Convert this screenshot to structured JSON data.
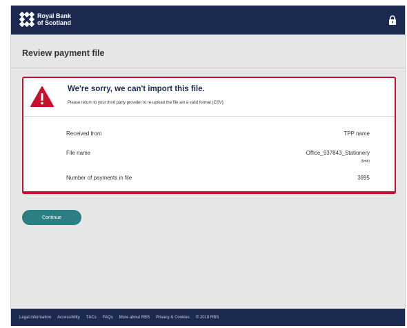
{
  "brand": {
    "line1": "Royal Bank",
    "line2": "of Scotland",
    "logo_icon": "rbs-daisy-logo",
    "lock_icon": "lock-icon",
    "navy": "#1c2a4f",
    "accent_red": "#c8102e",
    "teal": "#2b7f83"
  },
  "page": {
    "title": "Review payment file"
  },
  "error": {
    "icon": "warning-triangle-icon",
    "title": "We're sorry, we can't import this file.",
    "message": "Please return to your third party provider to re-upload the file ain a valid format (CSV)."
  },
  "details": {
    "rows": [
      {
        "label": "Received from",
        "value": "TPP name"
      },
      {
        "label": "File name",
        "value": "Office_937843_Stationery",
        "note": "(5mb)"
      },
      {
        "label": "Number of payments in file",
        "value": "3995"
      }
    ]
  },
  "actions": {
    "continue_label": "Continue"
  },
  "footer": {
    "links": [
      "Legal information",
      "Accessibility",
      "T&Cs",
      "FAQs",
      "More about RBS",
      "Privacy & Cookies"
    ],
    "copyright": "© 2019 RBS"
  }
}
